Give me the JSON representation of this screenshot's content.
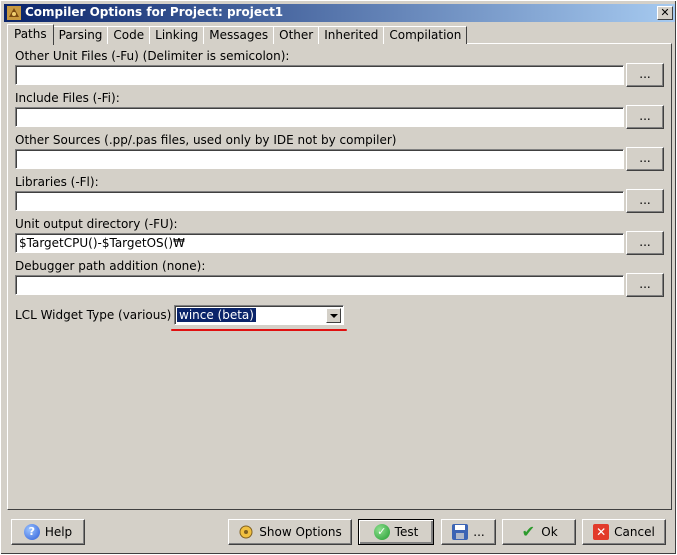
{
  "window": {
    "title": "Compiler Options for Project: project1",
    "close_label": "✕"
  },
  "tabs": [
    {
      "label": "Paths"
    },
    {
      "label": "Parsing"
    },
    {
      "label": "Code"
    },
    {
      "label": "Linking"
    },
    {
      "label": "Messages"
    },
    {
      "label": "Other"
    },
    {
      "label": "Inherited"
    },
    {
      "label": "Compilation"
    }
  ],
  "fields": [
    {
      "label": "Other Unit Files (-Fu) (Delimiter is semicolon):",
      "value": "",
      "button": "..."
    },
    {
      "label": "Include Files (-Fi):",
      "value": "",
      "button": "..."
    },
    {
      "label": "Other Sources (.pp/.pas files, used only by IDE not by compiler)",
      "value": "",
      "button": "..."
    },
    {
      "label": "Libraries (-Fl):",
      "value": "",
      "button": "..."
    },
    {
      "label": "Unit output directory (-FU):",
      "value": "$TargetCPU()-$TargetOS()₩",
      "button": "..."
    },
    {
      "label": "Debugger path addition (none):",
      "value": "",
      "button": "..."
    }
  ],
  "widget_type": {
    "label": "LCL Widget Type (various)",
    "selected": "wince (beta)"
  },
  "buttons": {
    "help": "Help",
    "show_options": "Show Options",
    "test": "Test",
    "save": "...",
    "ok": "Ok",
    "cancel": "Cancel"
  },
  "colors": {
    "titlebar_start": "#0a246a",
    "titlebar_end": "#a6caf0",
    "selection": "#0a246a",
    "annotation_underline": "#e01010"
  }
}
